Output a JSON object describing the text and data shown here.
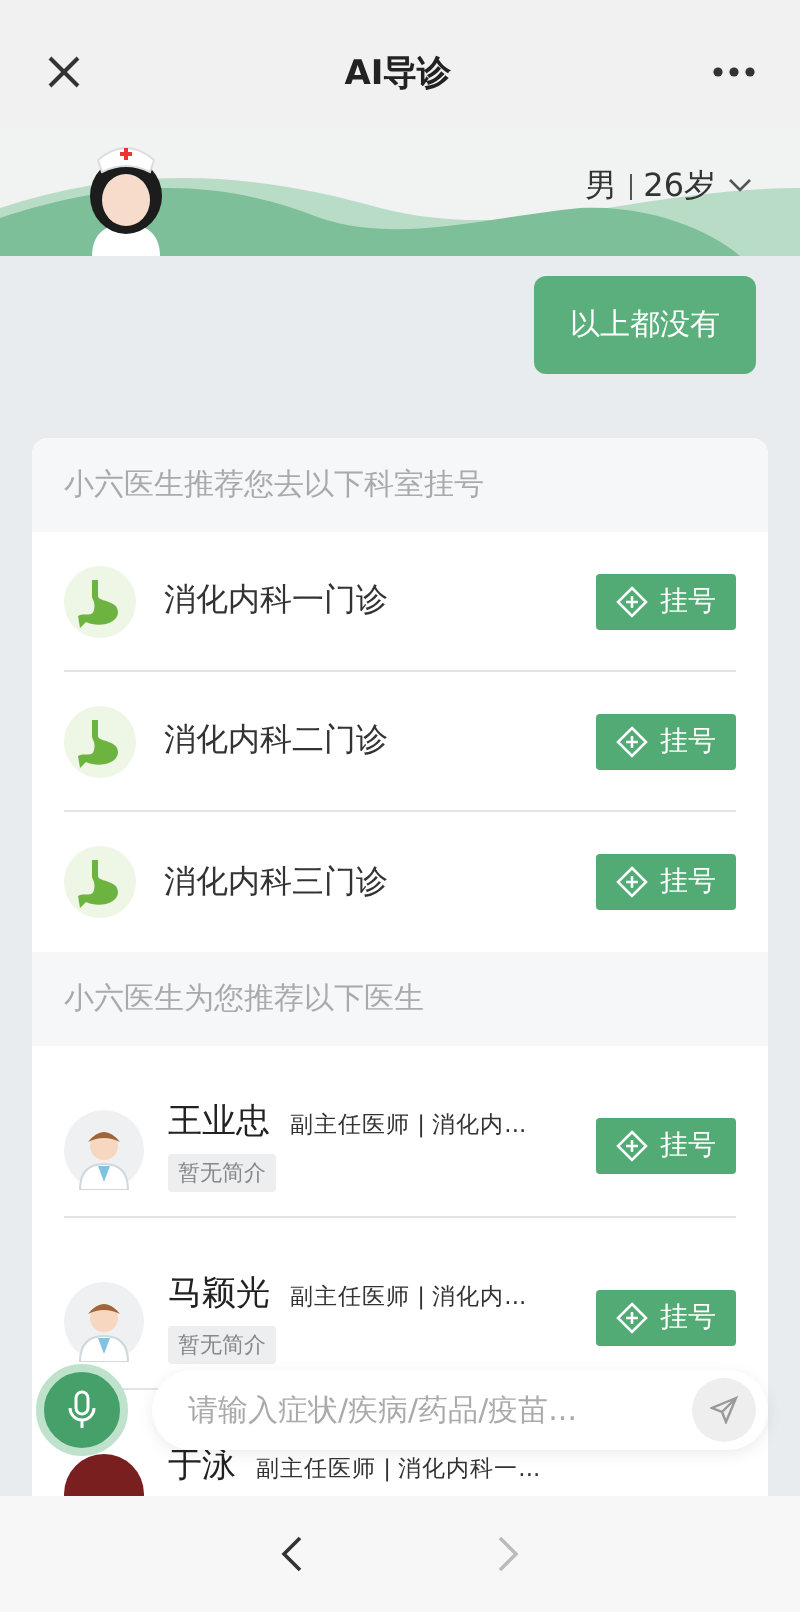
{
  "header": {
    "title": "AI导诊"
  },
  "profile": {
    "gender": "男",
    "age": "26岁"
  },
  "messages": [
    {
      "text": "以上都没有"
    }
  ],
  "departments": {
    "title": "小六医生推荐您去以下科室挂号",
    "items": [
      {
        "name": "消化内科一门诊",
        "button": "挂号"
      },
      {
        "name": "消化内科二门诊",
        "button": "挂号"
      },
      {
        "name": "消化内科三门诊",
        "button": "挂号"
      }
    ]
  },
  "doctors": {
    "title": "小六医生为您推荐以下医生",
    "items": [
      {
        "kind": "doctor",
        "name": "王业忠",
        "title": "副主任医师 | 消化内...",
        "tag": "暂无简介",
        "button": "挂号"
      },
      {
        "kind": "doctor",
        "name": "马颖光",
        "title": "副主任医师 | 消化内...",
        "tag": "暂无简介",
        "button": "挂号"
      },
      {
        "kind": "photo",
        "name": "于泳",
        "title": "副主任医师 | 消化内科一..."
      }
    ]
  },
  "input": {
    "placeholder": "请输入症状/疾病/药品/疫苗..."
  }
}
